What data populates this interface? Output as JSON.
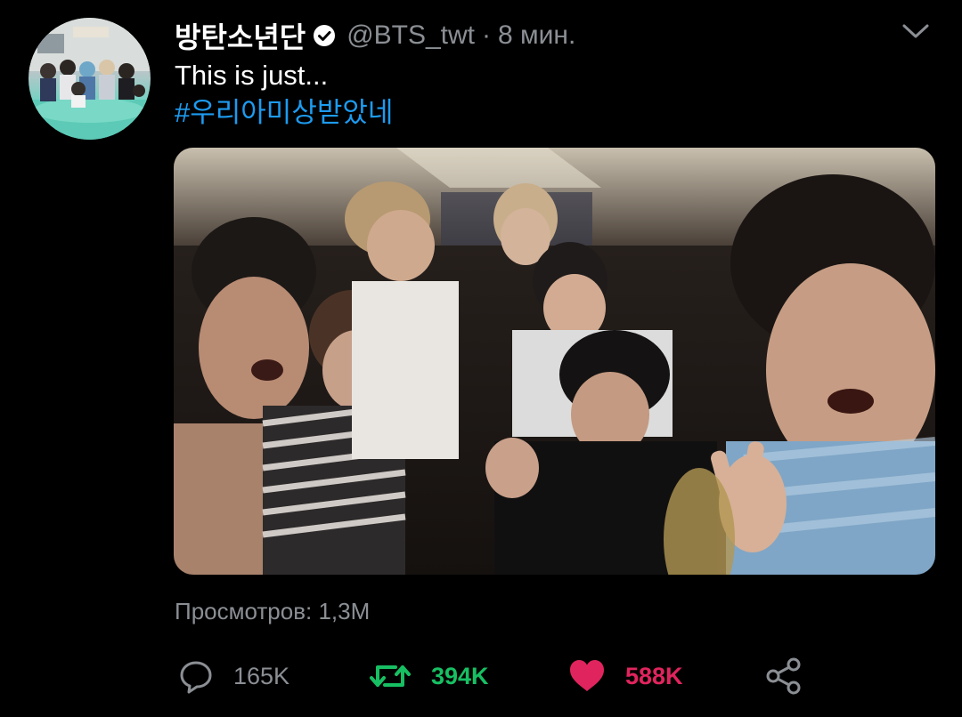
{
  "tweet": {
    "display_name": "방탄소년단",
    "handle": "@BTS_twt",
    "separator": "·",
    "time": "8 мин.",
    "text": "This is just...",
    "hashtag": "#우리아미상받았네"
  },
  "stats": {
    "views": "Просмотров: 1,3M",
    "replies": "165K",
    "retweets": "394K",
    "likes": "588K"
  },
  "colors": {
    "background": "#000000",
    "link": "#1d9bf0",
    "muted": "#8b8f94",
    "retweet": "#17bf63",
    "like": "#e0245e"
  },
  "icons": {
    "verified": "verified-badge-icon",
    "more": "chevron-down-icon",
    "reply": "comment-bubble-icon",
    "retweet": "retweet-icon",
    "like": "heart-icon",
    "share": "share-icon"
  }
}
